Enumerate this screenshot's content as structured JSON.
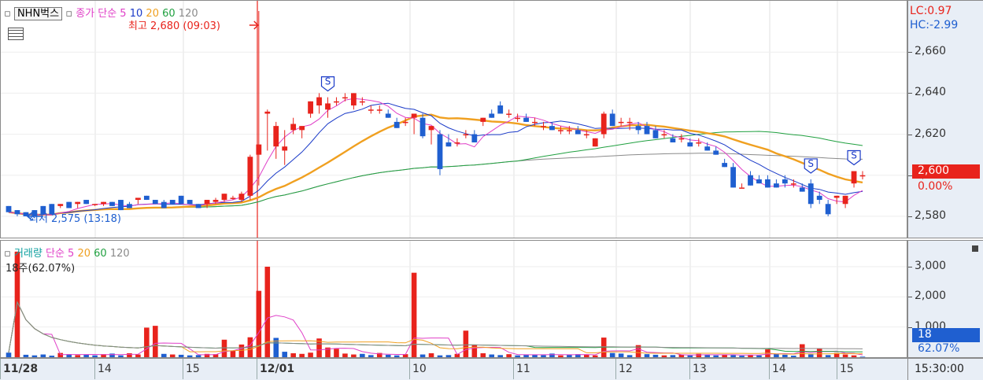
{
  "legend_price": {
    "symbol": "NHN벅스",
    "ma_title": "종가 단순 5",
    "ma10": "10",
    "ma20": "20",
    "ma60": "60",
    "ma120": "120"
  },
  "legend_volume": {
    "title": "거래량",
    "ma_title": "단순 5",
    "ma20": "20",
    "ma60": "60",
    "ma120": "120",
    "current": "18주(62.07%)"
  },
  "annotations": {
    "high": "최고 2,680 (09:03)",
    "low": "최저 2,575 (13:18)",
    "signal": "S"
  },
  "right_axis": {
    "lc": "LC:0.97",
    "hc": "HC:-2.99",
    "price_ticks": [
      "2,660",
      "2,640",
      "2,620",
      "2,600",
      "2,580"
    ],
    "current_price": "2,600",
    "current_change": "0.00%",
    "volume_ticks": [
      "3,000",
      "2,000",
      "1,000"
    ],
    "current_volume": "18",
    "current_volume_pct": "62.07%",
    "time_label": "15:30:00"
  },
  "x_axis": {
    "labels": [
      "11/28",
      "14",
      "15",
      "12/01",
      "10",
      "11",
      "12",
      "13",
      "14",
      "15"
    ]
  },
  "colors": {
    "up": "#e8231c",
    "down": "#1f5fd0",
    "ma5": "#e040c8",
    "ma10": "#1a3ac8",
    "ma20": "#f0a020",
    "ma60": "#20a040",
    "ma120": "#8a8a8a",
    "axis_bg": "#e8eef6"
  },
  "chart_data": {
    "type": "candlestick+volume",
    "sessions": [
      {
        "date": "11/28",
        "hours": [
          "",
          "14",
          "15"
        ]
      },
      {
        "date": "12/01",
        "hours": [
          "",
          "10",
          "11",
          "12",
          "13",
          "14",
          "15"
        ]
      }
    ],
    "price_axis": {
      "ylim": [
        2570,
        2685
      ],
      "ticks": [
        2580,
        2600,
        2620,
        2640,
        2660
      ]
    },
    "volume_axis": {
      "ylim": [
        0,
        3600
      ],
      "ticks": [
        1000,
        2000,
        3000
      ]
    },
    "candles": [
      [
        2585,
        2585,
        2582,
        2582
      ],
      [
        2583,
        2583,
        2580,
        2581
      ],
      [
        2582,
        2582,
        2580,
        2580
      ],
      [
        2583,
        2583,
        2580,
        2580
      ],
      [
        2585,
        2585,
        2581,
        2581
      ],
      [
        2586,
        2586,
        2581,
        2581
      ],
      [
        2585,
        2586,
        2584,
        2586
      ],
      [
        2587,
        2587,
        2584,
        2584
      ],
      [
        2586,
        2587,
        2584,
        2587
      ],
      [
        2588,
        2588,
        2586,
        2586
      ],
      [
        2586,
        2586,
        2585,
        2586
      ],
      [
        2586,
        2587,
        2585,
        2587
      ],
      [
        2587,
        2587,
        2585,
        2585
      ],
      [
        2588,
        2588,
        2583,
        2583
      ],
      [
        2586,
        2587,
        2584,
        2584
      ],
      [
        2588,
        2589,
        2586,
        2589
      ],
      [
        2590,
        2590,
        2588,
        2588
      ],
      [
        2588,
        2588,
        2586,
        2586
      ],
      [
        2587,
        2588,
        2584,
        2584
      ],
      [
        2588,
        2588,
        2586,
        2586
      ],
      [
        2590,
        2590,
        2586,
        2586
      ],
      [
        2588,
        2588,
        2586,
        2586
      ],
      [
        2586,
        2586,
        2584,
        2584
      ],
      [
        2586,
        2588,
        2584,
        2588
      ],
      [
        2587,
        2589,
        2586,
        2588
      ],
      [
        2588,
        2591,
        2587,
        2591
      ],
      [
        2589,
        2590,
        2588,
        2589
      ],
      [
        2588,
        2592,
        2587,
        2591
      ],
      [
        2590,
        2610,
        2588,
        2609
      ],
      [
        2610,
        2680,
        2595,
        2615
      ],
      [
        2630,
        2632,
        2612,
        2631
      ],
      [
        2614,
        2626,
        2608,
        2624
      ],
      [
        2612,
        2622,
        2605,
        2614
      ],
      [
        2622,
        2628,
        2620,
        2625
      ],
      [
        2622,
        2624,
        2618,
        2624
      ],
      [
        2630,
        2636,
        2628,
        2636
      ],
      [
        2634,
        2640,
        2630,
        2638
      ],
      [
        2632,
        2638,
        2628,
        2635
      ],
      [
        2636,
        2638,
        2634,
        2636
      ],
      [
        2638,
        2640,
        2636,
        2638
      ],
      [
        2634,
        2640,
        2632,
        2640
      ],
      [
        2636,
        2638,
        2634,
        2636
      ],
      [
        2632,
        2634,
        2630,
        2632
      ],
      [
        2632,
        2634,
        2630,
        2632
      ],
      [
        2630,
        2632,
        2628,
        2628
      ],
      [
        2626,
        2628,
        2623,
        2623
      ],
      [
        2626,
        2628,
        2624,
        2626
      ],
      [
        2628,
        2630,
        2620,
        2630
      ],
      [
        2628,
        2630,
        2618,
        2619
      ],
      [
        2622,
        2624,
        2615,
        2624
      ],
      [
        2620,
        2622,
        2600,
        2603
      ],
      [
        2616,
        2620,
        2614,
        2614
      ],
      [
        2616,
        2618,
        2614,
        2616
      ],
      [
        2620,
        2622,
        2618,
        2620
      ],
      [
        2620,
        2622,
        2616,
        2616
      ],
      [
        2626,
        2628,
        2624,
        2628
      ],
      [
        2630,
        2632,
        2628,
        2628
      ],
      [
        2634,
        2636,
        2630,
        2630
      ],
      [
        2630,
        2632,
        2628,
        2630
      ],
      [
        2628,
        2630,
        2626,
        2628
      ],
      [
        2628,
        2630,
        2626,
        2626
      ],
      [
        2626,
        2628,
        2624,
        2626
      ],
      [
        2624,
        2626,
        2622,
        2624
      ],
      [
        2624,
        2626,
        2622,
        2622
      ],
      [
        2622,
        2624,
        2620,
        2622
      ],
      [
        2622,
        2624,
        2620,
        2622
      ],
      [
        2622,
        2624,
        2620,
        2620
      ],
      [
        2620,
        2622,
        2618,
        2620
      ],
      [
        2614,
        2618,
        2614,
        2618
      ],
      [
        2620,
        2631,
        2618,
        2630
      ],
      [
        2630,
        2632,
        2624,
        2624
      ],
      [
        2626,
        2628,
        2624,
        2626
      ],
      [
        2626,
        2628,
        2622,
        2626
      ],
      [
        2624,
        2626,
        2620,
        2622
      ],
      [
        2624,
        2626,
        2620,
        2620
      ],
      [
        2622,
        2624,
        2618,
        2618
      ],
      [
        2620,
        2622,
        2618,
        2620
      ],
      [
        2618,
        2620,
        2616,
        2616
      ],
      [
        2618,
        2620,
        2616,
        2618
      ],
      [
        2616,
        2618,
        2614,
        2614
      ],
      [
        2616,
        2618,
        2614,
        2616
      ],
      [
        2614,
        2616,
        2612,
        2612
      ],
      [
        2612,
        2614,
        2610,
        2610
      ],
      [
        2606,
        2608,
        2604,
        2604
      ],
      [
        2604,
        2606,
        2594,
        2594
      ],
      [
        2594,
        2596,
        2594,
        2594
      ],
      [
        2600,
        2602,
        2595,
        2595
      ],
      [
        2598,
        2600,
        2596,
        2596
      ],
      [
        2598,
        2600,
        2594,
        2594
      ],
      [
        2596,
        2598,
        2594,
        2594
      ],
      [
        2598,
        2600,
        2594,
        2596
      ],
      [
        2596,
        2598,
        2594,
        2596
      ],
      [
        2594,
        2596,
        2592,
        2592
      ],
      [
        2596,
        2598,
        2584,
        2586
      ],
      [
        2590,
        2592,
        2586,
        2588
      ],
      [
        2586,
        2588,
        2580,
        2581
      ],
      [
        2589,
        2590,
        2586,
        2590
      ],
      [
        2586,
        2590,
        2584,
        2590
      ],
      [
        2596,
        2602,
        2594,
        2602
      ],
      [
        2600,
        2602,
        2598,
        2600
      ]
    ],
    "volume": [
      150,
      3500,
      80,
      60,
      90,
      50,
      140,
      100,
      70,
      90,
      60,
      100,
      120,
      60,
      130,
      90,
      980,
      1040,
      110,
      90,
      80,
      60,
      70,
      110,
      100,
      580,
      220,
      420,
      660,
      2200,
      3000,
      640,
      180,
      130,
      110,
      150,
      620,
      320,
      280,
      120,
      90,
      110,
      70,
      140,
      80,
      60,
      100,
      2800,
      90,
      130,
      60,
      70,
      110,
      880,
      420,
      130,
      90,
      70,
      100,
      60,
      90,
      80,
      70,
      120,
      60,
      80,
      100,
      90,
      60,
      650,
      140,
      120,
      70,
      400,
      100,
      80,
      60,
      70,
      90,
      60,
      110,
      80,
      60,
      90,
      70,
      50,
      80,
      60,
      260,
      110,
      80,
      50,
      430,
      90,
      280,
      70,
      140,
      90,
      60,
      18
    ],
    "volume_up": [
      false,
      true,
      false,
      false,
      false,
      false,
      true,
      false,
      true,
      false,
      false,
      true,
      false,
      false,
      true,
      true,
      true,
      true,
      false,
      true,
      false,
      false,
      false,
      true,
      true,
      true,
      true,
      true,
      true,
      true,
      true,
      false,
      false,
      true,
      true,
      true,
      true,
      true,
      true,
      true,
      true,
      false,
      false,
      true,
      false,
      false,
      true,
      true,
      false,
      true,
      false,
      false,
      true,
      true,
      true,
      true,
      false,
      false,
      true,
      false,
      false,
      false,
      false,
      false,
      true,
      false,
      false,
      true,
      true,
      true,
      false,
      false,
      false,
      true,
      false,
      false,
      true,
      false,
      true,
      false,
      true,
      false,
      false,
      true,
      false,
      false,
      true,
      false,
      true,
      false,
      false,
      false,
      true,
      false,
      true,
      false,
      true,
      true,
      true,
      false
    ],
    "signals": [
      37,
      93,
      98
    ],
    "high_point": {
      "index": 29,
      "price": 2680,
      "time": "09:03"
    },
    "low_point": {
      "index": 2,
      "price": 2575,
      "time": "13:18"
    }
  }
}
